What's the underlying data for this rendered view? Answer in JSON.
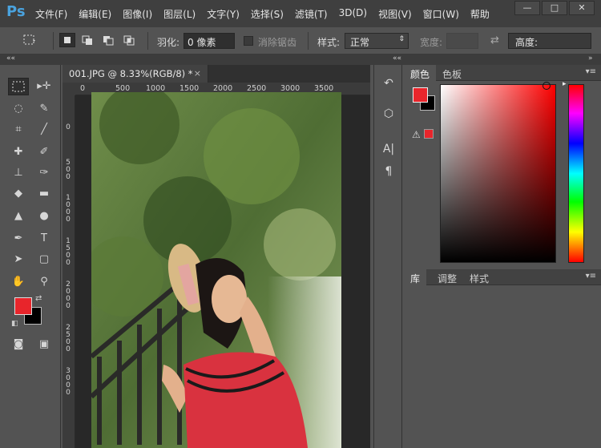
{
  "app": {
    "logo_text": "Ps"
  },
  "menu": [
    "文件(F)",
    "编辑(E)",
    "图像(I)",
    "图层(L)",
    "文字(Y)",
    "选择(S)",
    "滤镜(T)",
    "3D(D)",
    "视图(V)",
    "窗口(W)",
    "帮助"
  ],
  "window_controls": {
    "minimize": "—",
    "restore": "□",
    "close": "✕"
  },
  "options": {
    "feather_label": "羽化:",
    "feather_value": "0 像素",
    "antialias_label": "消除锯齿",
    "style_label": "样式:",
    "style_value": "正常",
    "width_label": "宽度:",
    "height_label": "高度:"
  },
  "document": {
    "tab_title": "001.JPG @ 8.33%(RGB/8) *",
    "tab_close": "×",
    "ruler_h_ticks": [
      "0",
      "500",
      "1000",
      "1500",
      "2000",
      "2500",
      "3000",
      "3500"
    ],
    "ruler_v_ticks": [
      "0",
      "5\n0\n0",
      "1\n0\n0\n0",
      "1\n5\n0\n0",
      "2\n0\n0\n0",
      "2\n5\n0\n0",
      "3\n0\n0\n0"
    ]
  },
  "color_panel": {
    "tabs": [
      "颜色",
      "色板"
    ],
    "foreground": "#e8252b",
    "background": "#000000",
    "warning_icon": "gamut-warning-icon"
  },
  "library_panel": {
    "tabs": [
      "库",
      "调整",
      "样式"
    ]
  },
  "colors": {
    "foreground": "#e8252b",
    "background": "#000000",
    "accent": "#4aa3df"
  }
}
